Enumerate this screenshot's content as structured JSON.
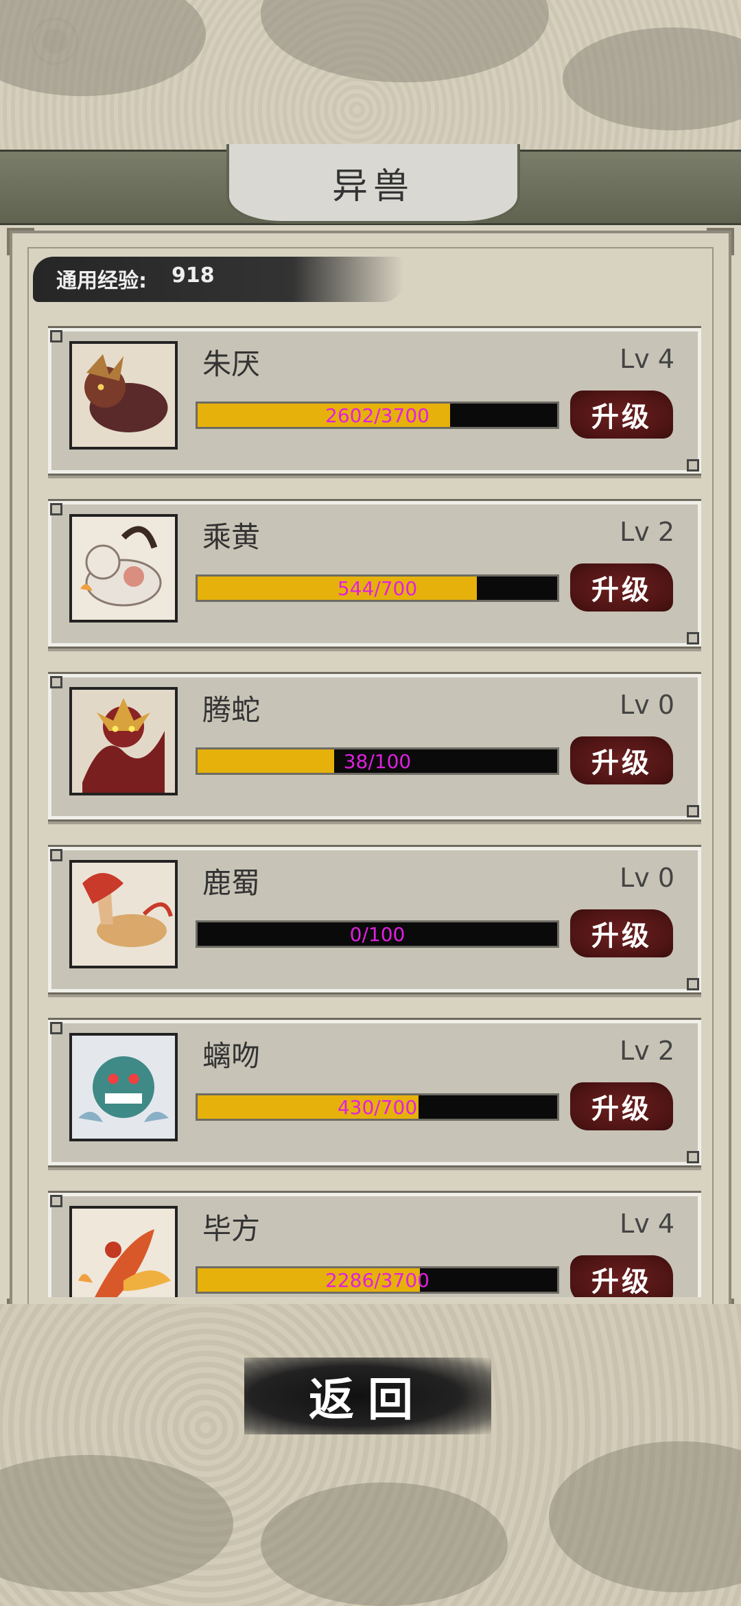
{
  "header": {
    "title": "异兽"
  },
  "experience": {
    "label": "通用经验:",
    "value": "918"
  },
  "beasts": [
    {
      "name": "朱厌",
      "level": "Lv 4",
      "progress": "2602/3700",
      "fraction": 0.703,
      "upgrade": "升级",
      "portrait_colors": [
        "#5a2a2a",
        "#b07a3a"
      ]
    },
    {
      "name": "乘黄",
      "level": "Lv 2",
      "progress": "544/700",
      "fraction": 0.777,
      "upgrade": "升级",
      "portrait_colors": [
        "#e8e2da",
        "#d36b5a"
      ]
    },
    {
      "name": "腾蛇",
      "level": "Lv 0",
      "progress": "38/100",
      "fraction": 0.38,
      "upgrade": "升级",
      "portrait_colors": [
        "#7a1f1f",
        "#d8a23c"
      ]
    },
    {
      "name": "鹿蜀",
      "level": "Lv 0",
      "progress": "0/100",
      "fraction": 0.0,
      "upgrade": "升级",
      "portrait_colors": [
        "#c93a2a",
        "#d9a86a"
      ]
    },
    {
      "name": "螭吻",
      "level": "Lv 2",
      "progress": "430/700",
      "fraction": 0.614,
      "upgrade": "升级",
      "portrait_colors": [
        "#3f8a86",
        "#8ab0c6"
      ]
    },
    {
      "name": "毕方",
      "level": "Lv 4",
      "progress": "2286/3700",
      "fraction": 0.618,
      "upgrade": "升级",
      "portrait_colors": [
        "#d9582a",
        "#f0b040"
      ]
    }
  ],
  "footer": {
    "back_label": "返回"
  }
}
